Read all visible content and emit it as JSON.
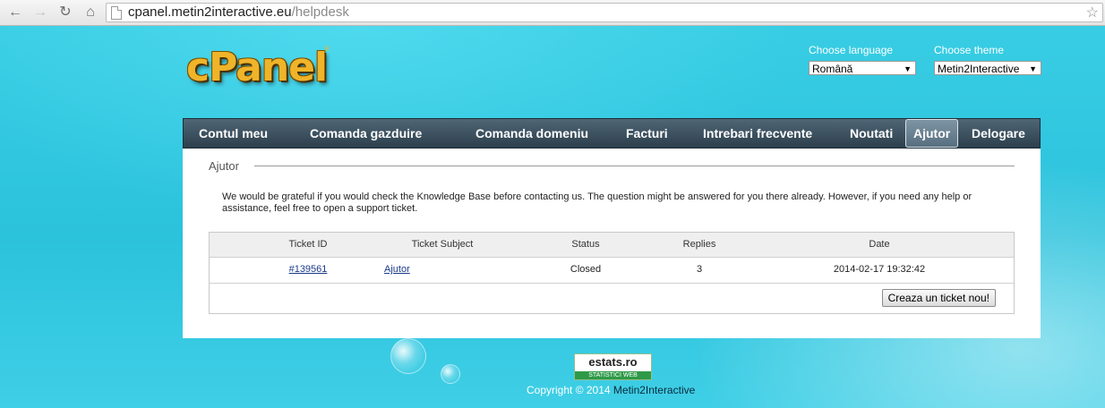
{
  "browser": {
    "url_host": "cpanel.metin2interactive.eu",
    "url_path": "/helpdesk",
    "back_icon": "arrow-left",
    "forward_icon": "arrow-right",
    "reload_icon": "reload",
    "home_icon": "home",
    "star_icon": "star"
  },
  "header": {
    "logo_text": "cPanel",
    "logo_mark": "®",
    "language_label": "Choose language",
    "language_value": "Română",
    "theme_label": "Choose theme",
    "theme_value": "Metin2Interactive"
  },
  "nav": {
    "items": [
      {
        "label": "Contul meu"
      },
      {
        "label": "Comanda gazduire"
      },
      {
        "label": "Comanda domeniu"
      },
      {
        "label": "Facturi"
      },
      {
        "label": "Intrebari frecvente"
      },
      {
        "label": "Noutati"
      },
      {
        "label": "Ajutor"
      },
      {
        "label": "Delogare"
      }
    ],
    "active": "Ajutor"
  },
  "main": {
    "section_title": "Ajutor",
    "intro": "We would be grateful if you would check the Knowledge Base before contacting us. The question might be answered for you there already. However, if you need any help or assistance, feel free to open a support ticket.",
    "table": {
      "headers": [
        "Ticket ID",
        "Ticket Subject",
        "Status",
        "Replies",
        "Date"
      ],
      "rows": [
        {
          "id": "#139561",
          "subject": "Ajutor",
          "status": "Closed",
          "replies": "3",
          "date": "2014-02-17 19:32:42"
        }
      ]
    },
    "new_ticket_label": "Creaza un ticket nou!"
  },
  "footer": {
    "estats_main": "estats.ro",
    "estats_sub": "STATISTICI WEB",
    "copyright_prefix": "Copyright © 2014",
    "copyright_brand": "Metin2Interactive"
  }
}
